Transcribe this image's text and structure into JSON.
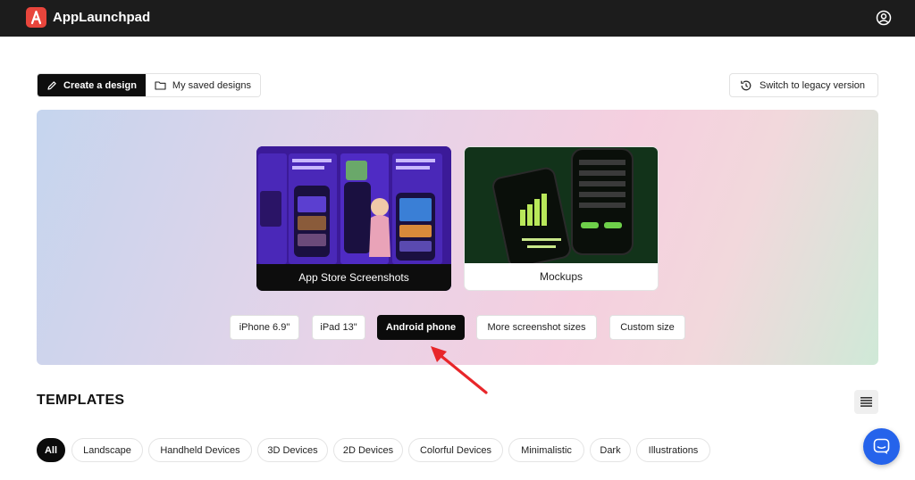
{
  "header": {
    "brand": "AppLaunchpad"
  },
  "tabs": {
    "create": "Create a design",
    "saved": "My saved designs"
  },
  "legacy_label": "Switch to legacy version",
  "cards": {
    "appstore": "App Store Screenshots",
    "mockups": "Mockups"
  },
  "size_chips": [
    "iPhone 6.9\"",
    "iPad 13\"",
    "Android phone",
    "More screenshot sizes",
    "Custom size"
  ],
  "selected_size": "Android phone",
  "templates": {
    "title": "TEMPLATES",
    "filters": [
      "All",
      "Landscape",
      "Handheld Devices",
      "3D Devices",
      "2D Devices",
      "Colorful Devices",
      "Minimalistic",
      "Dark",
      "Illustrations"
    ],
    "selected_filter": "All"
  },
  "colors": {
    "accent_red": "#e8453c",
    "arrow_red": "#e8262a",
    "chat_blue": "#2563eb",
    "topbar": "#1c1c1c"
  },
  "icons": {
    "user": "user-circle-icon",
    "pen": "pen-icon",
    "folder": "folder-icon",
    "history": "history-icon",
    "list": "list-icon",
    "chat": "chat-icon"
  }
}
